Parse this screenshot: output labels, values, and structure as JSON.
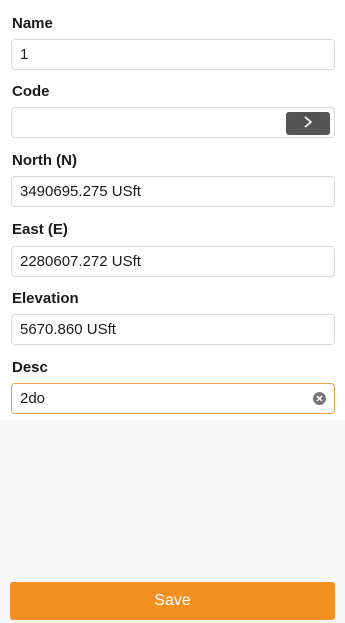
{
  "fields": {
    "name": {
      "label": "Name",
      "value": "1"
    },
    "code": {
      "label": "Code",
      "value": ""
    },
    "north": {
      "label": "North (N)",
      "value": "3490695.275 USft"
    },
    "east": {
      "label": "East (E)",
      "value": "2280607.272 USft"
    },
    "elevation": {
      "label": "Elevation",
      "value": "5670.860 USft"
    },
    "desc": {
      "label": "Desc",
      "value": "2do"
    }
  },
  "icons": {
    "code_arrow": "chevron-right-icon",
    "desc_clear": "clear-icon"
  },
  "colors": {
    "accent": "#f39021",
    "focus_border": "#f0a04b",
    "arrow_button": "#555555"
  },
  "actions": {
    "save_label": "Save"
  }
}
